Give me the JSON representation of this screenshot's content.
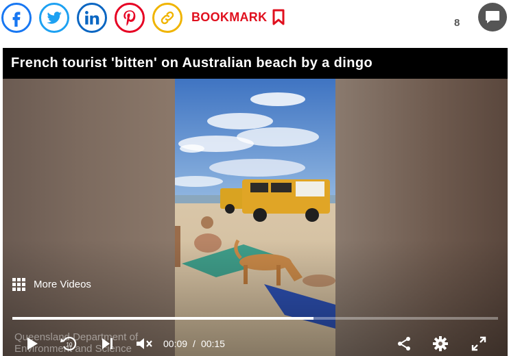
{
  "share": {
    "facebook_icon": "facebook-icon",
    "twitter_icon": "twitter-icon",
    "linkedin_icon": "linkedin-icon",
    "pinterest_icon": "pinterest-icon",
    "link_icon": "link-icon",
    "bookmark_label": "BOOKMARK",
    "comment_count": "8"
  },
  "colors": {
    "facebook": "#1877f2",
    "twitter": "#1da1f2",
    "linkedin": "#0a66c2",
    "pinterest": "#e60023",
    "link": "#f0b400",
    "bookmark": "#e0101e"
  },
  "video": {
    "title": "French tourist 'bitten' on Australian beach by a dingo",
    "more_videos_label": "More Videos",
    "watermark_line1": "Queensland Department of",
    "watermark_line2": "Environment and Science",
    "current_time": "00:09",
    "time_separator": "/",
    "duration": "00:15",
    "progress": 0.62
  }
}
